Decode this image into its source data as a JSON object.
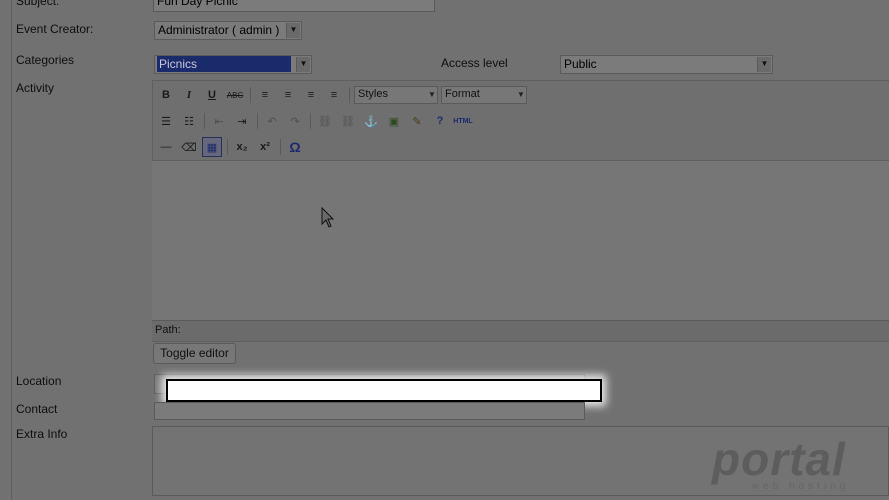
{
  "form": {
    "subject": {
      "label": "Subject:",
      "value": "Fun Day Picnic"
    },
    "event_creator": {
      "label": "Event Creator:",
      "value": "Administrator ( admin )"
    },
    "categories": {
      "label": "Categories",
      "value": "Picnics"
    },
    "access_level": {
      "label": "Access level",
      "value": "Public"
    },
    "activity": {
      "label": "Activity"
    },
    "location": {
      "label": "Location",
      "value": ""
    },
    "contact": {
      "label": "Contact",
      "value": ""
    },
    "extra_info": {
      "label": "Extra Info"
    }
  },
  "editor": {
    "toolbar_row1": [
      {
        "name": "bold-icon",
        "glyph": "B"
      },
      {
        "name": "italic-icon",
        "glyph": "I"
      },
      {
        "name": "underline-icon",
        "glyph": "U"
      },
      {
        "name": "strikethrough-icon",
        "glyph": "ABC"
      },
      {
        "name": "align-left-icon",
        "glyph": "≡"
      },
      {
        "name": "align-center-icon",
        "glyph": "≡"
      },
      {
        "name": "align-right-icon",
        "glyph": "≡"
      },
      {
        "name": "align-justify-icon",
        "glyph": "≡"
      }
    ],
    "styles_label": "Styles",
    "format_label": "Format",
    "toolbar_row2": [
      {
        "name": "bullet-list-icon",
        "glyph": "☰"
      },
      {
        "name": "numbered-list-icon",
        "glyph": "☷"
      },
      {
        "name": "outdent-icon",
        "glyph": "⇤"
      },
      {
        "name": "indent-icon",
        "glyph": "⇥"
      },
      {
        "name": "undo-icon",
        "glyph": "↶"
      },
      {
        "name": "redo-icon",
        "glyph": "↷"
      },
      {
        "name": "link-icon",
        "glyph": "⛓"
      },
      {
        "name": "unlink-icon",
        "glyph": "⛓"
      },
      {
        "name": "anchor-icon",
        "glyph": "⚓"
      },
      {
        "name": "image-icon",
        "glyph": "▣"
      },
      {
        "name": "cleanup-icon",
        "glyph": "✎"
      },
      {
        "name": "help-icon",
        "glyph": "?"
      },
      {
        "name": "html-icon",
        "glyph": "HTML"
      }
    ],
    "toolbar_row3": [
      {
        "name": "horizontal-rule-icon",
        "glyph": "—"
      },
      {
        "name": "remove-format-icon",
        "glyph": "⌫"
      },
      {
        "name": "table-icon",
        "glyph": "▦"
      },
      {
        "name": "subscript-icon",
        "glyph": "x₂"
      },
      {
        "name": "superscript-icon",
        "glyph": "x²"
      },
      {
        "name": "special-char-icon",
        "glyph": "Ω"
      }
    ],
    "path_label": "Path:",
    "toggle_label": "Toggle editor"
  },
  "watermark": {
    "text": "portal",
    "sub": "web hosting"
  },
  "colors": {
    "overlay": "#717171",
    "selection": "#1b2a6b",
    "highlight": "#ffffff"
  }
}
